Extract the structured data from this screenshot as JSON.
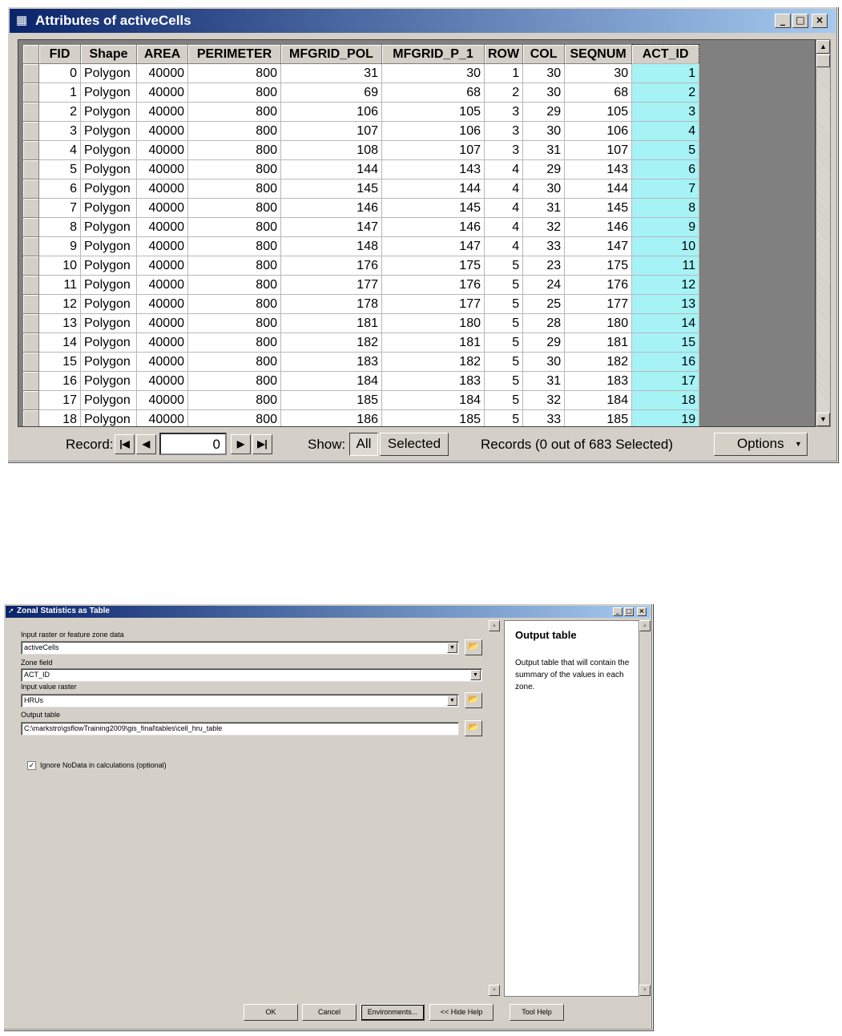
{
  "attr_window": {
    "title": "Attributes of activeCells",
    "columns": [
      "FID",
      "Shape",
      "AREA",
      "PERIMETER",
      "MFGRID_POL",
      "MFGRID_P_1",
      "ROW",
      "COL",
      "SEQNUM",
      "ACT_ID"
    ],
    "rows": [
      [
        "0",
        "Polygon",
        "40000",
        "800",
        "31",
        "30",
        "1",
        "30",
        "30",
        "1"
      ],
      [
        "1",
        "Polygon",
        "40000",
        "800",
        "69",
        "68",
        "2",
        "30",
        "68",
        "2"
      ],
      [
        "2",
        "Polygon",
        "40000",
        "800",
        "106",
        "105",
        "3",
        "29",
        "105",
        "3"
      ],
      [
        "3",
        "Polygon",
        "40000",
        "800",
        "107",
        "106",
        "3",
        "30",
        "106",
        "4"
      ],
      [
        "4",
        "Polygon",
        "40000",
        "800",
        "108",
        "107",
        "3",
        "31",
        "107",
        "5"
      ],
      [
        "5",
        "Polygon",
        "40000",
        "800",
        "144",
        "143",
        "4",
        "29",
        "143",
        "6"
      ],
      [
        "6",
        "Polygon",
        "40000",
        "800",
        "145",
        "144",
        "4",
        "30",
        "144",
        "7"
      ],
      [
        "7",
        "Polygon",
        "40000",
        "800",
        "146",
        "145",
        "4",
        "31",
        "145",
        "8"
      ],
      [
        "8",
        "Polygon",
        "40000",
        "800",
        "147",
        "146",
        "4",
        "32",
        "146",
        "9"
      ],
      [
        "9",
        "Polygon",
        "40000",
        "800",
        "148",
        "147",
        "4",
        "33",
        "147",
        "10"
      ],
      [
        "10",
        "Polygon",
        "40000",
        "800",
        "176",
        "175",
        "5",
        "23",
        "175",
        "11"
      ],
      [
        "11",
        "Polygon",
        "40000",
        "800",
        "177",
        "176",
        "5",
        "24",
        "176",
        "12"
      ],
      [
        "12",
        "Polygon",
        "40000",
        "800",
        "178",
        "177",
        "5",
        "25",
        "177",
        "13"
      ],
      [
        "13",
        "Polygon",
        "40000",
        "800",
        "181",
        "180",
        "5",
        "28",
        "180",
        "14"
      ],
      [
        "14",
        "Polygon",
        "40000",
        "800",
        "182",
        "181",
        "5",
        "29",
        "181",
        "15"
      ],
      [
        "15",
        "Polygon",
        "40000",
        "800",
        "183",
        "182",
        "5",
        "30",
        "182",
        "16"
      ],
      [
        "16",
        "Polygon",
        "40000",
        "800",
        "184",
        "183",
        "5",
        "31",
        "183",
        "17"
      ],
      [
        "17",
        "Polygon",
        "40000",
        "800",
        "185",
        "184",
        "5",
        "32",
        "184",
        "18"
      ],
      [
        "18",
        "Polygon",
        "40000",
        "800",
        "186",
        "185",
        "5",
        "33",
        "185",
        "19"
      ]
    ],
    "footer": {
      "record_label": "Record:",
      "record_value": "0",
      "show_label": "Show:",
      "all_label": "All",
      "selected_label": "Selected",
      "records_status": "Records (0 out of 683 Selected)",
      "options_label": "Options"
    }
  },
  "zs_window": {
    "title": "Zonal Statistics as Table",
    "input_label": "Input raster or feature zone data",
    "input_value": "activeCells",
    "zone_label": "Zone field",
    "zone_value": "ACT_ID",
    "value_raster_label": "Input value raster",
    "value_raster_value": "HRUs",
    "output_label": "Output table",
    "output_value": "C:\\markstro\\gsflowTraining2009\\gis_final\\tables\\cell_hru_table",
    "ignore_nodata_label": "Ignore NoData in calculations (optional)",
    "ignore_nodata_checked": true,
    "help_title": "Output table",
    "help_text": "Output table that will contain the summary of the values in each zone.",
    "buttons": {
      "ok": "OK",
      "cancel": "Cancel",
      "environments": "Environments...",
      "hide_help": "<< Hide Help",
      "tool_help": "Tool Help"
    }
  },
  "colors": {
    "title_active": "#0a246a",
    "title_gradient_end": "#a6caf0",
    "face": "#d4d0c8",
    "selected_column": "#a6f3f6"
  }
}
